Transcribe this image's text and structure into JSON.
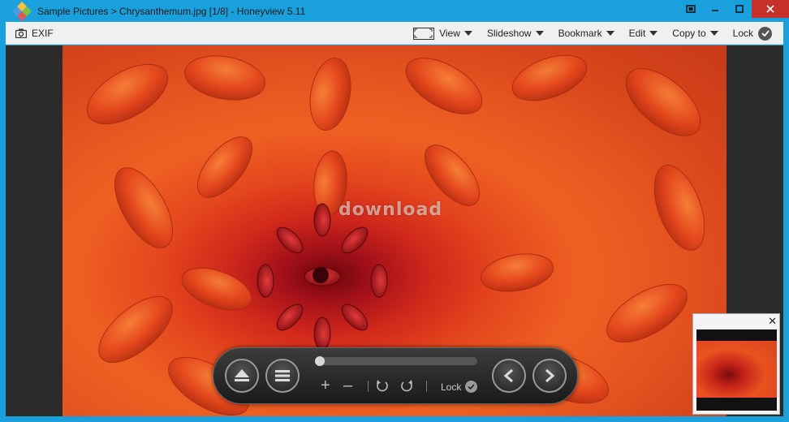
{
  "window": {
    "title": "Sample Pictures > Chrysanthemum.jpg [1/8] - Honeyview 5.11"
  },
  "toolbar": {
    "exif_label": "EXIF",
    "view_label": "View",
    "slideshow_label": "Slideshow",
    "bookmark_label": "Bookmark",
    "edit_label": "Edit",
    "copyto_label": "Copy to",
    "lock_label": "Lock"
  },
  "image": {
    "watermark": "download"
  },
  "controller": {
    "seek_position": 0.03,
    "lock_label": "Lock"
  },
  "colors": {
    "titlebar": "#1aa1dd",
    "close_button": "#c7312b",
    "viewer_bg": "#2b2b2b",
    "toolbar_bg": "#f0f0f0"
  }
}
